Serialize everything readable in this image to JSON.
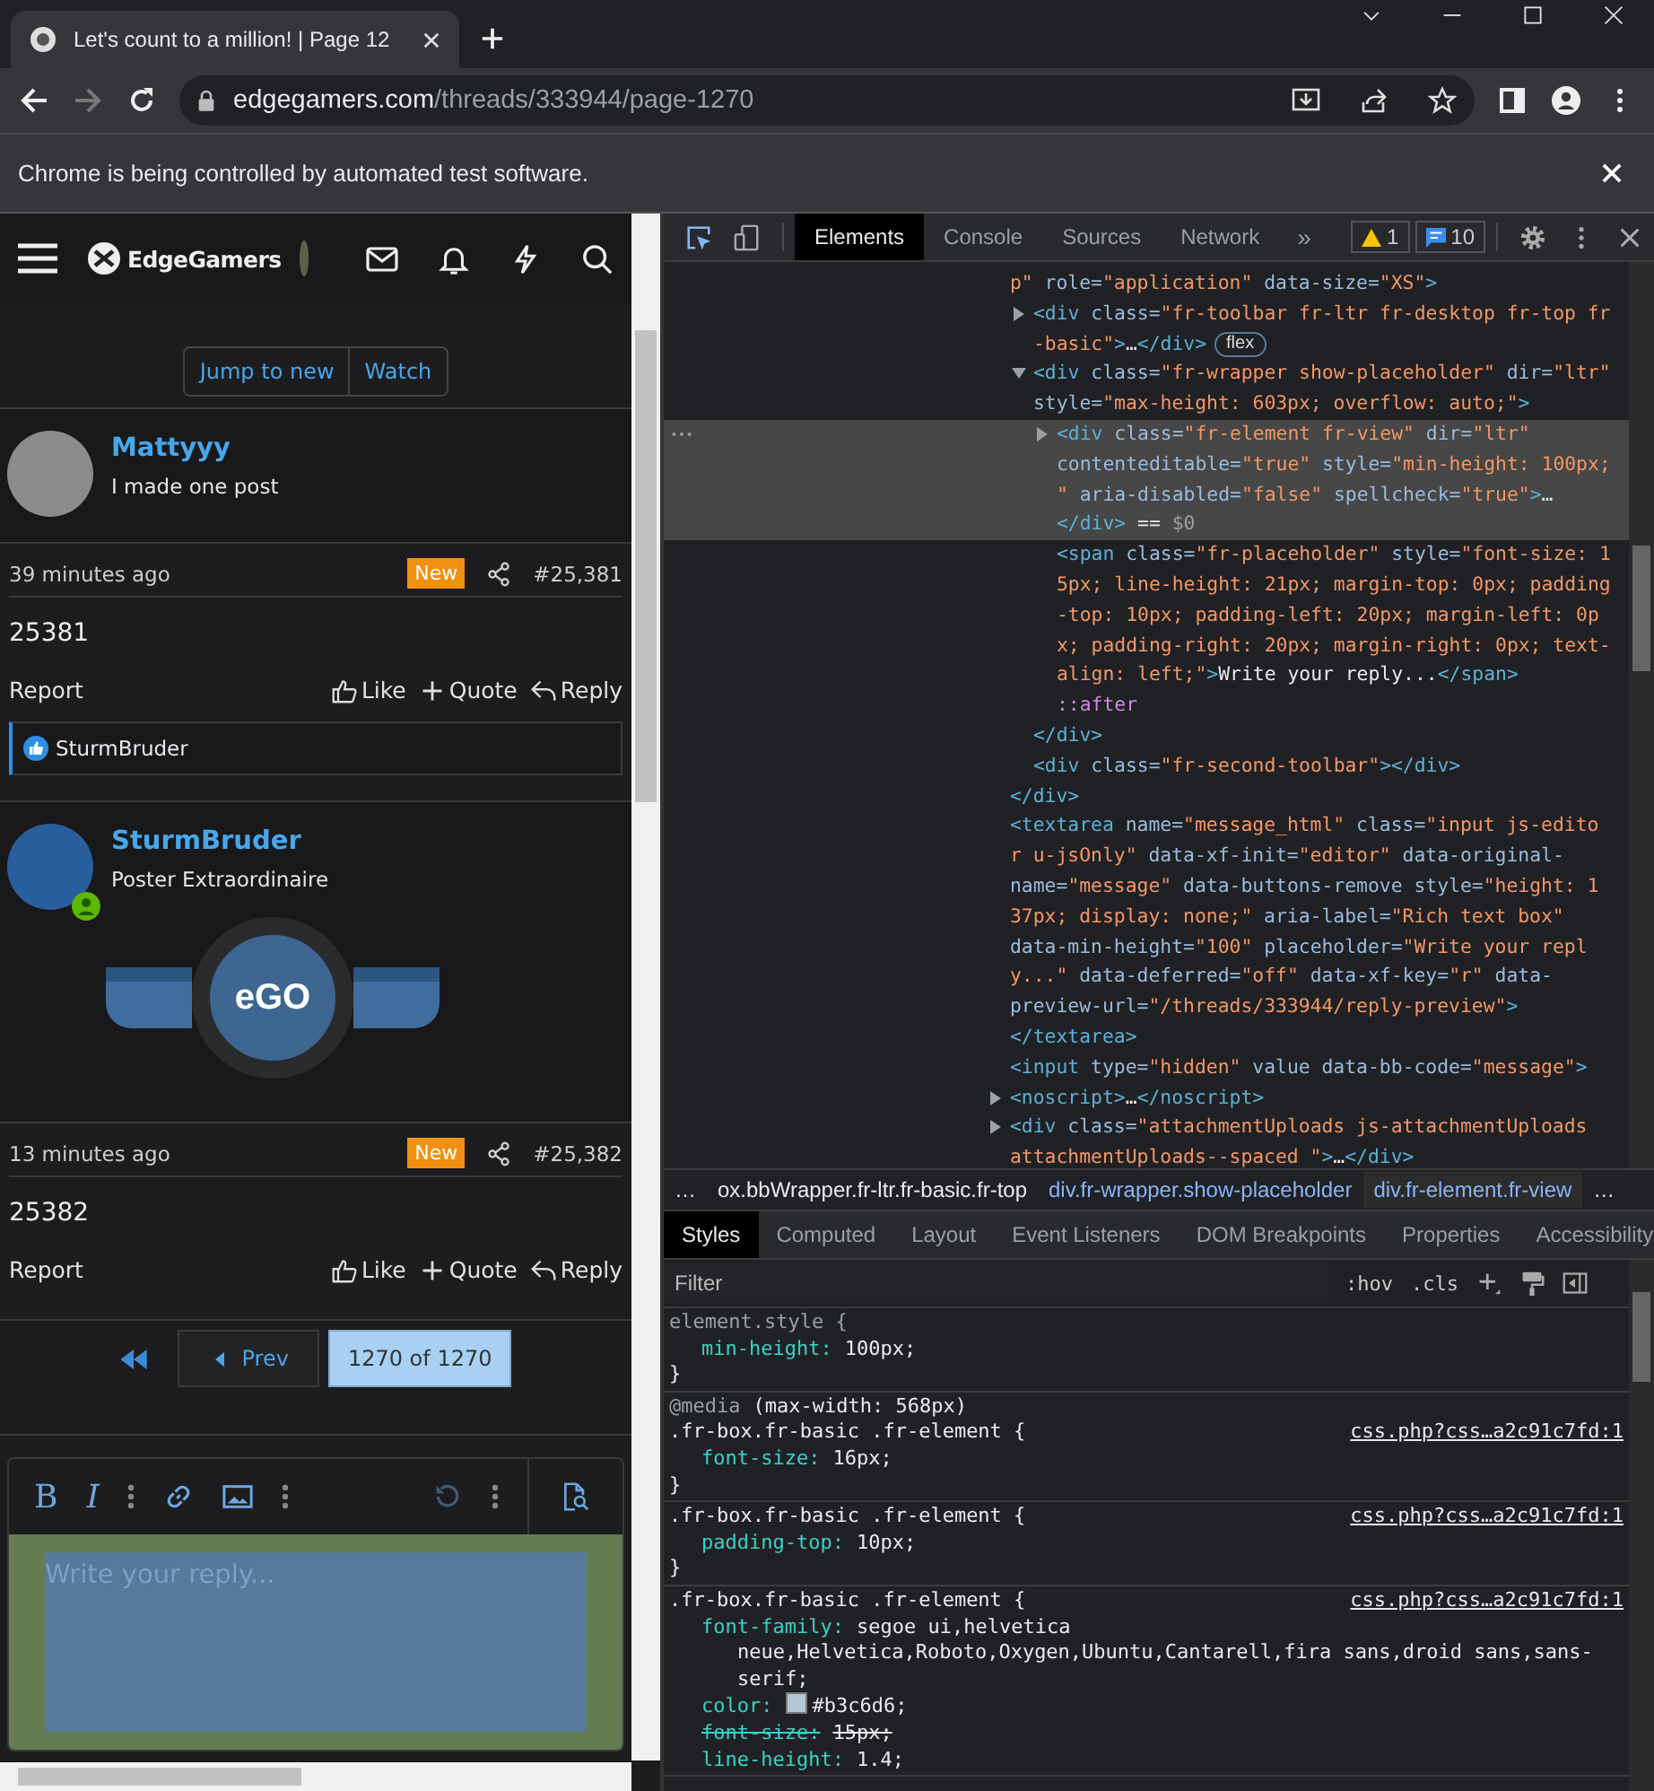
{
  "browser": {
    "tab": {
      "title": "Let's count to a million! | Page 12",
      "selected": true
    },
    "url": {
      "host": "edgegamers.com",
      "path": "/threads/333944/page-1270"
    },
    "infobar": {
      "message": "Chrome is being controlled by automated test software."
    }
  },
  "forum": {
    "logo": "EdgeGamers",
    "thread_buttons": [
      {
        "label": "Jump to new"
      },
      {
        "label": "Watch"
      }
    ],
    "posts": [
      {
        "author": "Mattyyy",
        "user_title": "I made one post",
        "online": false,
        "time": "39 minutes ago",
        "badge": "New",
        "number": "#25,381",
        "body": "25381",
        "actions": [
          {
            "kind": "report",
            "label": "Report"
          },
          {
            "kind": "like",
            "label": "Like"
          },
          {
            "kind": "quote",
            "label": "Quote"
          },
          {
            "kind": "reply",
            "label": "Reply"
          }
        ],
        "reactions": {
          "users": "SturmBruder"
        }
      },
      {
        "author": "SturmBruder",
        "user_title": "Poster Extraordinaire",
        "online": true,
        "banner": {
          "text": "eGO"
        },
        "time": "13 minutes ago",
        "badge": "New",
        "number": "#25,382",
        "body": "25382",
        "actions": [
          {
            "kind": "report",
            "label": "Report"
          },
          {
            "kind": "like",
            "label": "Like"
          },
          {
            "kind": "quote",
            "label": "Quote"
          },
          {
            "kind": "reply",
            "label": "Reply"
          }
        ]
      }
    ],
    "pagination": {
      "prev": "Prev",
      "current": "1270 of 1270"
    },
    "editor": {
      "toolbar": [
        {
          "kind": "glyph",
          "text": "B",
          "disabled": false
        },
        {
          "kind": "glyph",
          "text": "I",
          "disabled": false
        },
        {
          "kind": "more",
          "disabled": false
        },
        {
          "kind": "link",
          "disabled": false
        },
        {
          "kind": "image",
          "disabled": false
        },
        {
          "kind": "more",
          "disabled": false
        },
        {
          "kind": "undo",
          "disabled": true
        },
        {
          "kind": "more",
          "disabled": false
        },
        {
          "kind": "preview",
          "disabled": false
        }
      ],
      "placeholder": "Write your reply..."
    }
  },
  "devtools": {
    "tabs": [
      {
        "label": "Elements",
        "selected": true
      },
      {
        "label": "Console",
        "selected": false
      },
      {
        "label": "Sources",
        "selected": false
      },
      {
        "label": "Network",
        "selected": false
      }
    ],
    "overflow": "»",
    "warnings": "1",
    "messages": "10",
    "dom_tree": [
      {
        "selected": false,
        "lines": [
          [
            {
              "kind": "value",
              "text": "p\""
            },
            {
              "kind": "attr",
              "text": " role="
            },
            {
              "kind": "value",
              "text": "\"application\""
            },
            {
              "kind": "attr",
              "text": " data-size="
            },
            {
              "kind": "value",
              "text": "\"XS\""
            },
            {
              "kind": "tag",
              "text": ">"
            }
          ]
        ],
        "children": [
          {
            "selected": false,
            "expanded": false,
            "badge": "flex",
            "lines": [
              [
                {
                  "kind": "tag",
                  "text": "<div"
                },
                {
                  "kind": "attr",
                  "text": " class="
                },
                {
                  "kind": "value",
                  "text": "\"fr-toolbar fr-ltr fr-desktop fr-top fr"
                }
              ],
              [
                {
                  "kind": "value",
                  "text": "-basic\""
                },
                {
                  "kind": "tag",
                  "text": ">"
                },
                {
                  "kind": "text",
                  "text": "…"
                },
                {
                  "kind": "tag",
                  "text": "</div>"
                }
              ]
            ]
          },
          {
            "selected": false,
            "expanded": true,
            "lines": [
              [
                {
                  "kind": "tag",
                  "text": "<div"
                },
                {
                  "kind": "attr",
                  "text": " class="
                },
                {
                  "kind": "value",
                  "text": "\"fr-wrapper show-placeholder\""
                },
                {
                  "kind": "attr",
                  "text": " dir="
                },
                {
                  "kind": "value",
                  "text": "\"ltr\""
                }
              ],
              [
                {
                  "kind": "attr",
                  "text": "style="
                },
                {
                  "kind": "value",
                  "text": "\"max-height: 603px; overflow: auto;\""
                },
                {
                  "kind": "tag",
                  "text": ">"
                }
              ]
            ],
            "children": [
              {
                "selected": true,
                "expanded": false,
                "lines": [
                  [
                    {
                      "kind": "tag",
                      "text": "<div"
                    },
                    {
                      "kind": "attr",
                      "text": " class="
                    },
                    {
                      "kind": "value",
                      "text": "\"fr-element fr-view\""
                    },
                    {
                      "kind": "attr",
                      "text": " dir="
                    },
                    {
                      "kind": "value",
                      "text": "\"ltr\""
                    }
                  ],
                  [
                    {
                      "kind": "attr",
                      "text": "contenteditable="
                    },
                    {
                      "kind": "value",
                      "text": "\"true\""
                    },
                    {
                      "kind": "attr",
                      "text": " style="
                    },
                    {
                      "kind": "value",
                      "text": "\"min-height: 100px;"
                    }
                  ],
                  [
                    {
                      "kind": "value",
                      "text": "\""
                    },
                    {
                      "kind": "attr",
                      "text": " aria-disabled="
                    },
                    {
                      "kind": "value",
                      "text": "\"false\""
                    },
                    {
                      "kind": "attr",
                      "text": " spellcheck="
                    },
                    {
                      "kind": "value",
                      "text": "\"true\""
                    },
                    {
                      "kind": "tag",
                      "text": ">"
                    },
                    {
                      "kind": "text",
                      "text": "…"
                    }
                  ],
                  [
                    {
                      "kind": "tag",
                      "text": "</div>"
                    },
                    {
                      "kind": "text",
                      "text": " == "
                    },
                    {
                      "kind": "dim",
                      "text": "$0"
                    }
                  ]
                ]
              },
              {
                "selected": false,
                "lines": [
                  [
                    {
                      "kind": "tag",
                      "text": "<span"
                    },
                    {
                      "kind": "attr",
                      "text": " class="
                    },
                    {
                      "kind": "value",
                      "text": "\"fr-placeholder\""
                    },
                    {
                      "kind": "attr",
                      "text": " style="
                    },
                    {
                      "kind": "value",
                      "text": "\"font-size: 1"
                    }
                  ],
                  [
                    {
                      "kind": "value",
                      "text": "5px; line-height: 21px; margin-top: 0px; padding"
                    }
                  ],
                  [
                    {
                      "kind": "value",
                      "text": "-top: 10px; padding-left: 20px; margin-left: 0p"
                    }
                  ],
                  [
                    {
                      "kind": "value",
                      "text": "x; padding-right: 20px; margin-right: 0px; text-"
                    }
                  ],
                  [
                    {
                      "kind": "value",
                      "text": "align: left;\""
                    },
                    {
                      "kind": "tag",
                      "text": ">"
                    },
                    {
                      "kind": "text",
                      "text": "Write your reply..."
                    },
                    {
                      "kind": "tag",
                      "text": "</span>"
                    }
                  ]
                ]
              },
              {
                "selected": false,
                "lines": [
                  [
                    {
                      "kind": "pseudo",
                      "text": "::after"
                    }
                  ]
                ]
              }
            ],
            "closing": [
              [
                {
                  "kind": "tag",
                  "text": "</div>"
                }
              ]
            ]
          },
          {
            "selected": false,
            "lines": [
              [
                {
                  "kind": "tag",
                  "text": "<div"
                },
                {
                  "kind": "attr",
                  "text": " class="
                },
                {
                  "kind": "value",
                  "text": "\"fr-second-toolbar\""
                },
                {
                  "kind": "tag",
                  "text": "></div>"
                }
              ]
            ]
          }
        ],
        "closing": [
          [
            {
              "kind": "tag",
              "text": "</div>"
            }
          ]
        ]
      },
      {
        "selected": false,
        "lines": [
          [
            {
              "kind": "tag",
              "text": "<textarea"
            },
            {
              "kind": "attr",
              "text": " name="
            },
            {
              "kind": "value",
              "text": "\"message_html\""
            },
            {
              "kind": "attr",
              "text": " class="
            },
            {
              "kind": "value",
              "text": "\"input js-edito"
            }
          ],
          [
            {
              "kind": "value",
              "text": "r u-jsOnly\""
            },
            {
              "kind": "attr",
              "text": " data-xf-init="
            },
            {
              "kind": "value",
              "text": "\"editor\""
            },
            {
              "kind": "attr",
              "text": " data-original-"
            }
          ],
          [
            {
              "kind": "attr",
              "text": "name="
            },
            {
              "kind": "value",
              "text": "\"message\""
            },
            {
              "kind": "attr",
              "text": " data-buttons-remove style="
            },
            {
              "kind": "value",
              "text": "\"height: 1"
            }
          ],
          [
            {
              "kind": "value",
              "text": "37px; display: none;\""
            },
            {
              "kind": "attr",
              "text": " aria-label="
            },
            {
              "kind": "value",
              "text": "\"Rich text box\""
            }
          ],
          [
            {
              "kind": "attr",
              "text": "data-min-height="
            },
            {
              "kind": "value",
              "text": "\"100\""
            },
            {
              "kind": "attr",
              "text": " placeholder="
            },
            {
              "kind": "value",
              "text": "\"Write your repl"
            }
          ],
          [
            {
              "kind": "value",
              "text": "y...\""
            },
            {
              "kind": "attr",
              "text": " data-deferred="
            },
            {
              "kind": "value",
              "text": "\"off\""
            },
            {
              "kind": "attr",
              "text": " data-xf-key="
            },
            {
              "kind": "value",
              "text": "\"r\""
            },
            {
              "kind": "attr",
              "text": " data-"
            }
          ],
          [
            {
              "kind": "attr",
              "text": "preview-url="
            },
            {
              "kind": "value",
              "text": "\"/threads/333944/reply-preview\""
            },
            {
              "kind": "tag",
              "text": ">"
            }
          ],
          [
            {
              "kind": "tag",
              "text": "</textarea>"
            }
          ]
        ]
      },
      {
        "selected": false,
        "lines": [
          [
            {
              "kind": "tag",
              "text": "<input"
            },
            {
              "kind": "attr",
              "text": " type="
            },
            {
              "kind": "value",
              "text": "\"hidden\""
            },
            {
              "kind": "attr",
              "text": " value data-bb-code="
            },
            {
              "kind": "value",
              "text": "\"message\""
            },
            {
              "kind": "tag",
              "text": ">"
            }
          ]
        ]
      },
      {
        "selected": false,
        "expanded": false,
        "lines": [
          [
            {
              "kind": "tag",
              "text": "<noscript>"
            },
            {
              "kind": "text",
              "text": "…"
            },
            {
              "kind": "tag",
              "text": "</noscript>"
            }
          ]
        ]
      },
      {
        "selected": false,
        "expanded": false,
        "lines": [
          [
            {
              "kind": "tag",
              "text": "<div"
            },
            {
              "kind": "attr",
              "text": " class="
            },
            {
              "kind": "value",
              "text": "\"attachmentUploads js-attachmentUploads"
            }
          ],
          [
            {
              "kind": "value",
              "text": "attachmentUploads--spaced \""
            },
            {
              "kind": "tag",
              "text": ">"
            },
            {
              "kind": "text",
              "text": "…"
            },
            {
              "kind": "tag",
              "text": "</div>"
            }
          ]
        ]
      }
    ],
    "breadcrumbs": [
      {
        "label": "…",
        "selected": false
      },
      {
        "label": "ox.bbWrapper.fr-ltr.fr-basic.fr-top",
        "selected": false
      },
      {
        "label": "div.fr-wrapper.show-placeholder",
        "selected": false
      },
      {
        "label": "div.fr-element.fr-view",
        "selected": true
      },
      {
        "label": "…",
        "selected": false
      }
    ],
    "styles": {
      "tabs": [
        {
          "label": "Styles",
          "selected": true
        },
        {
          "label": "Computed",
          "selected": false
        },
        {
          "label": "Layout",
          "selected": false
        },
        {
          "label": "Event Listeners",
          "selected": false
        },
        {
          "label": "DOM Breakpoints",
          "selected": false
        },
        {
          "label": "Properties",
          "selected": false
        },
        {
          "label": "Accessibility",
          "selected": false
        }
      ],
      "filter_placeholder": "Filter",
      "toggles": [
        ":hov",
        ".cls"
      ],
      "rules": [
        {
          "kind": "inline",
          "selector": "element.style {",
          "declarations": [
            {
              "property": "min-height:",
              "value": "100px;",
              "overridden": false
            }
          ],
          "close": "}"
        },
        {
          "kind": "rule",
          "media": {
            "keyword": "@media",
            "query": "(max-width: 568px)"
          },
          "selector": ".fr-box.fr-basic .fr-element {",
          "source": "css.php?css…a2c91c7fd:1",
          "declarations": [
            {
              "property": "font-size:",
              "value": "16px;",
              "overridden": false
            }
          ],
          "close": "}"
        },
        {
          "kind": "rule",
          "selector": ".fr-box.fr-basic .fr-element {",
          "source": "css.php?css…a2c91c7fd:1",
          "declarations": [
            {
              "property": "padding-top:",
              "value": "10px;",
              "overridden": false
            }
          ],
          "close": "}"
        },
        {
          "kind": "rule",
          "selector": ".fr-box.fr-basic .fr-element {",
          "source": "css.php?css…a2c91c7fd:1",
          "declarations": [
            {
              "property": "font-family:",
              "value": "segoe ui,helvetica neue,Helvetica,Roboto,Oxygen,Ubuntu,Cantarell,fira sans,droid sans,sans-serif;",
              "overridden": false
            },
            {
              "property": "color:",
              "value": "#b3c6d6;",
              "color": "#b3c6d6",
              "overridden": false
            },
            {
              "property": "font-size:",
              "value": "15px;",
              "overridden": true
            },
            {
              "property": "line-height:",
              "value": "1.4;",
              "overridden": false
            }
          ]
        }
      ]
    }
  }
}
